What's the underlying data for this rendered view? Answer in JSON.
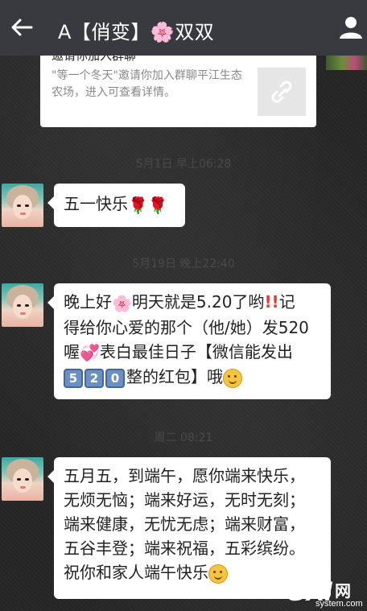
{
  "header": {
    "title": "A【俏变】🌸双双",
    "back_icon": "arrow-left-icon",
    "profile_icon": "person-icon",
    "bg_color": "#393a3f"
  },
  "invite_card": {
    "title": "邀请你加入群聊",
    "description": "\"等一个冬天\"邀请你加入群聊平江生态农场，进入可查看详情。",
    "link_icon": "link-icon"
  },
  "messages": [
    {
      "time": "5月1日 早上06:28"
    },
    {
      "lines": [
        "五一快乐🌹🌹"
      ]
    },
    {
      "time": "5月19日 晚上22:40"
    },
    {
      "lines": [
        "晚上好🌸明天就是5.20了哟‼️记",
        "得给你心爱的那个（他/她）发520",
        "喔💞表白最佳日子【微信能发出",
        "520整的红包】哦😊"
      ]
    },
    {
      "time": "周二 08:21"
    },
    {
      "lines": [
        "五月五，到端午，愿你端来快乐，",
        "无烦无恼；端来好运，无时无刻；",
        "端来健康，无忧无虑；端来财富，",
        "五谷丰登；端来祝福，五彩缤纷。",
        "祝你和家人端午快乐😊"
      ]
    }
  ],
  "msg2": {
    "l1a": "晚上好",
    "l1b": "明天就是5.20了哟",
    "l1c": "记",
    "l2": "得给你心爱的那个（他/她）发520",
    "l3a": "喔",
    "l3b": "表白最佳日子【微信能发出",
    "k1": "5",
    "k2": "2",
    "k3": "0",
    "l4b": "整的红包】哦"
  },
  "msg3": {
    "l5": "祝你和家人端午快乐"
  },
  "msg1": {
    "text": "五一快乐"
  },
  "watermark": {
    "brand": "GXI",
    "cn": "网",
    "domain": "system.com"
  }
}
